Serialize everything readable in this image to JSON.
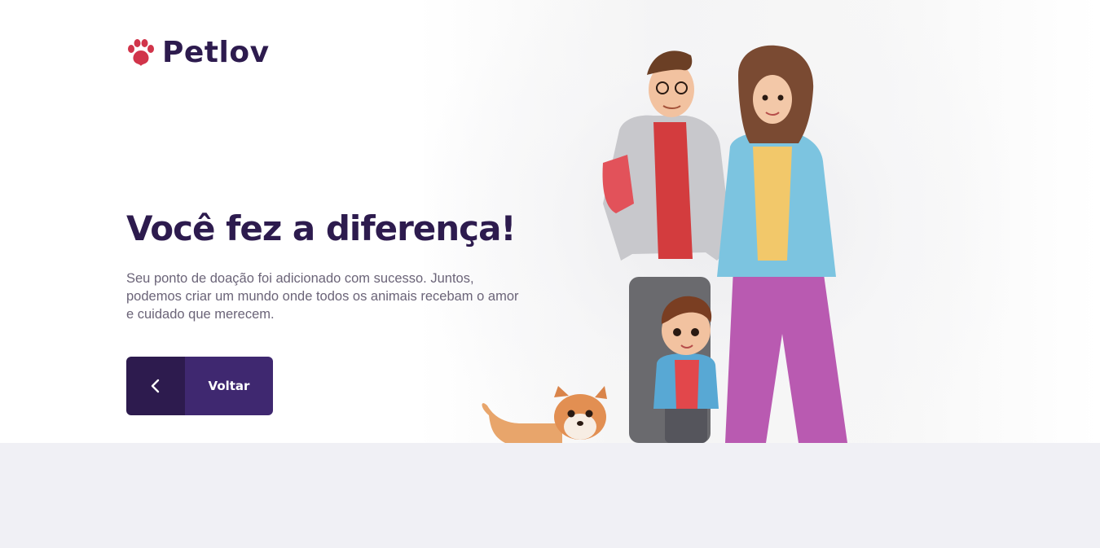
{
  "brand": {
    "name": "Petlov",
    "colors": {
      "primary_dark": "#2d1b4e",
      "primary": "#3f2870",
      "paw": "#d1344a",
      "text_muted": "#6b6478",
      "footer_band": "#f0f0f5"
    }
  },
  "hero": {
    "title": "Você fez a diferença!",
    "message": "Seu ponto de doação foi adicionado com sucesso. Juntos, podemos criar um mundo onde todos os animais recebam o amor e cuidado que merecem.",
    "back_button": {
      "icon": "chevron-left-icon",
      "label": "Voltar"
    },
    "illustration": {
      "icon": "family-with-dog-illustration"
    }
  },
  "logo_icon": "paw-icon"
}
